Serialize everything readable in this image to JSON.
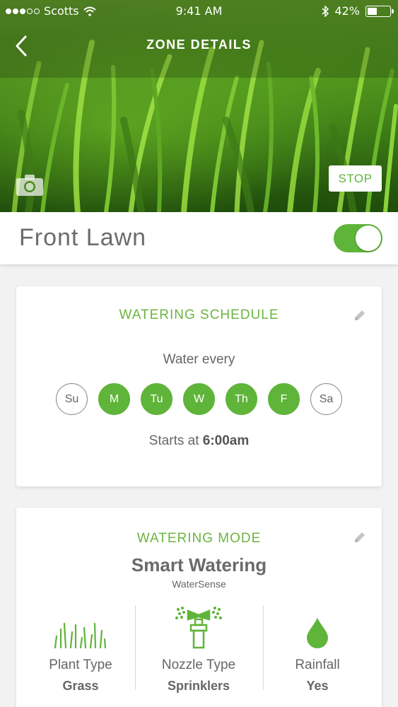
{
  "status_bar": {
    "carrier": "Scotts",
    "time": "9:41 AM",
    "battery": "42%",
    "battery_level": 0.42
  },
  "header": {
    "title": "ZONE DETAILS",
    "back_icon": "chevron-left-icon",
    "camera_icon": "camera-icon",
    "stop_label": "STOP"
  },
  "zone": {
    "name": "Front Lawn",
    "enabled": true
  },
  "schedule": {
    "title": "WATERING SCHEDULE",
    "water_every": "Water every",
    "days": [
      {
        "label": "Su",
        "active": false
      },
      {
        "label": "M",
        "active": true
      },
      {
        "label": "Tu",
        "active": true
      },
      {
        "label": "W",
        "active": true
      },
      {
        "label": "Th",
        "active": true
      },
      {
        "label": "F",
        "active": true
      },
      {
        "label": "Sa",
        "active": false
      }
    ],
    "starts_prefix": "Starts at",
    "start_time": "6:00am"
  },
  "mode": {
    "title": "WATERING MODE",
    "name": "Smart Watering",
    "subtitle": "WaterSense",
    "details": [
      {
        "label": "Plant Type",
        "value": "Grass",
        "icon": "grass-icon"
      },
      {
        "label": "Nozzle Type",
        "value": "Sprinklers",
        "icon": "sprinkler-icon"
      },
      {
        "label": "Rainfall",
        "value": "Yes",
        "icon": "raindrop-icon"
      }
    ]
  },
  "colors": {
    "accent": "#5fb43a",
    "card_title": "#6cb43f",
    "background": "#f2f2f3"
  }
}
